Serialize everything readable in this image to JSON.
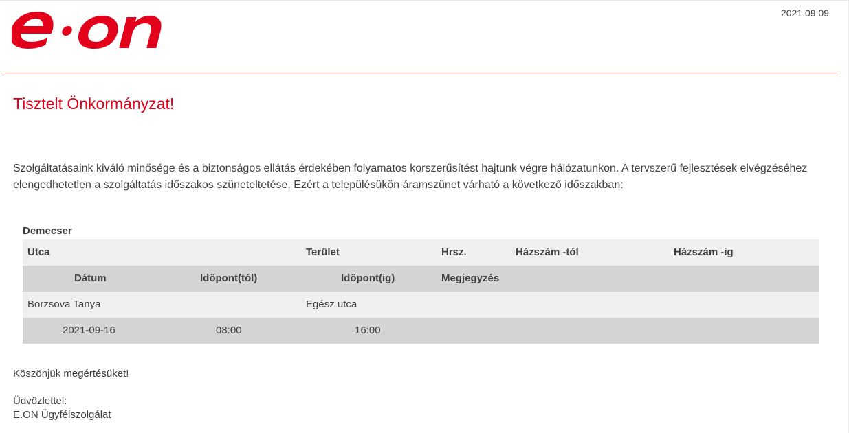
{
  "header": {
    "logo_text": "e·on",
    "date": "2021.09.09",
    "brand_color": "#e2001a"
  },
  "greeting": "Tisztelt Önkormányzat!",
  "intro": "Szolgáltatásaink kiváló minősége és a biztonságos ellátás érdekében folyamatos korszerűsítést hajtunk végre hálózatunkon. A tervszerű fejlesztések elvégzéséhez elengedhetetlen a szolgáltatás időszakos szüneteltetése. Ezért a településükön áramszünet várható a következő időszakban:",
  "outage": {
    "settlement": "Demecser",
    "street_headers": {
      "street": "Utca",
      "area": "Terület",
      "lot": "Hrsz.",
      "house_from": "Házszám -tól",
      "house_to": "Házszám -ig"
    },
    "time_headers": {
      "date": "Dátum",
      "time_from": "Időpont(tól)",
      "time_to": "Időpont(ig)",
      "note": "Megjegyzés"
    },
    "entries": [
      {
        "street": "Borzsova Tanya",
        "area": "Egész utca",
        "lot": "",
        "house_from": "",
        "house_to": "",
        "date": "2021-09-16",
        "time_from": "08:00",
        "time_to": "16:00",
        "note": ""
      }
    ]
  },
  "closing": {
    "thanks": "Köszönjük megértésüket!",
    "regards": "Üdvözlettel:",
    "signature": "E.ON Ügyfélszolgálat"
  }
}
